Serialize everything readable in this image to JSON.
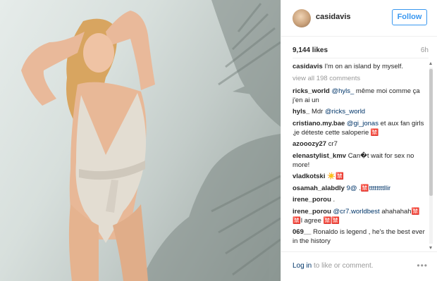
{
  "header": {
    "username": "casidavis",
    "follow_label": "Follow"
  },
  "post": {
    "likes": "9,144 likes",
    "time": "6h"
  },
  "caption": {
    "username": "casidavis",
    "text": "I'm on an island by myself."
  },
  "view_all": "view all 198 comments",
  "comments": [
    {
      "user": "ricks_world",
      "parts": [
        {
          "t": "@hyls_",
          "mention": true
        },
        {
          "t": " même moi comme ça j'en ai un"
        }
      ]
    },
    {
      "user": "hyls_",
      "parts": [
        {
          "t": "Mdr "
        },
        {
          "t": "@ricks_world",
          "mention": true
        }
      ]
    },
    {
      "user": "cristiano.my.bae",
      "parts": [
        {
          "t": "@gi_jonas",
          "mention": true
        },
        {
          "t": " et aux fan girls ,je déteste cette saloperie 🈲"
        }
      ]
    },
    {
      "user": "azooozy27",
      "parts": [
        {
          "t": "cr7"
        }
      ]
    },
    {
      "user": "elenastylist_kmv",
      "parts": [
        {
          "t": "Can�t wait for sex no more!"
        }
      ]
    },
    {
      "user": "vladkotski",
      "parts": [
        {
          "t": "☀️🈲"
        }
      ]
    },
    {
      "user": "osamah_alabdly",
      "parts": [
        {
          "t": "9@",
          "mention": true
        },
        {
          "t": " .🈲"
        },
        {
          "t": "ttttttttllir",
          "mention": true
        }
      ]
    },
    {
      "user": "irene_porou",
      "parts": [
        {
          "t": "."
        }
      ]
    },
    {
      "user": "irene_porou",
      "parts": [
        {
          "t": "@cr7.worldbest",
          "mention": true
        },
        {
          "t": " ahahahah🈲🈲l agree 🈲🈲"
        }
      ]
    },
    {
      "user": "069__",
      "parts": [
        {
          "t": "Ronaldo is legend , he's the best ever in the history"
        }
      ]
    }
  ],
  "footer": {
    "login_label": "Log in",
    "rest_text": " to like or comment.",
    "more_icon": "•••"
  },
  "colors": {
    "link": "#003569",
    "follow": "#3897f0",
    "muted": "#999999"
  }
}
